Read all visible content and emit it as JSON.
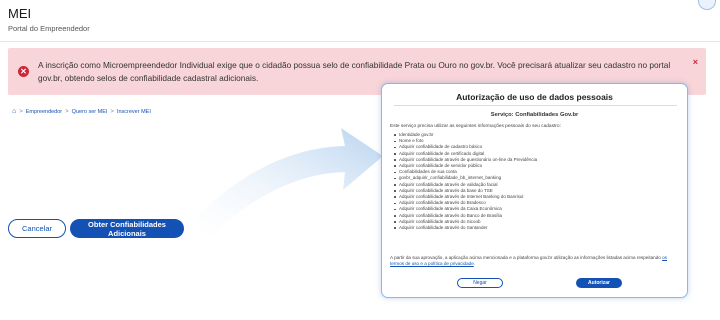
{
  "header": {
    "title": "MEI",
    "subtitle": "Portal do Empreendedor"
  },
  "alert": {
    "message": "A inscrição como Microempreendedor Individual exige que o cidadão possua selo de confiabilidade Prata ou Ouro no gov.br. Você precisará atualizar seu cadastro no portal gov.br, obtendo selos de confiabilidade cadastral adicionais.",
    "icon": "x-circle-icon",
    "close_label": "×",
    "color": "#d0263c"
  },
  "breadcrumb": {
    "items": [
      "Empreendedor",
      "Quero ser MEI",
      "Inscrever MEI"
    ],
    "separator": ">"
  },
  "actions": {
    "cancel_label": "Cancelar",
    "primary_label": "Obter Confiabilidades Adicionais",
    "accent": "#1351b4"
  },
  "modal": {
    "title": "Autorização de uso de dados pessoais",
    "service": "Serviço: Confiabilidades Gov.br",
    "intro": "Este serviço precisa utilizar as seguintes informações pessoais do seu cadastro:",
    "items": [
      "Identidade gov.br",
      "Nome e foto",
      "Adquirir confiabilidade de cadastro básico",
      "Adquirir confiabilidade de certificado digital",
      "Adquirir confiabilidade através de questionário on-line da Previdência",
      "Adquirir confiabilidade de servidor público",
      "Confiabilidades de sua conta",
      "govbr_adquirir_confiabilidade_bb_internet_banking",
      "Adquirir confiabilidade através de validação facial",
      "Adquirir confiabilidade através da base do TSE",
      "Adquirir confiabilidade através de Internet Banking do Banrisul",
      "Adquirir confiabilidade através do Bradesco",
      "Adquirir confiabilidade através da Caixa Econômica",
      "Adquirir confiabilidade através do Banco de Brasília",
      "Adquirir confiabilidade através do Sicoob",
      "Adquirir confiabilidade através do Santander"
    ],
    "consent_prefix": "A partir da sua aprovação, a aplicação acima mencionada e a plataforma gov.br utilização as informações listadas acima respeitando ",
    "consent_link": "os termos de uso e a política de privacidade",
    "consent_suffix": ".",
    "deny_label": "Negar",
    "authorize_label": "Autorizar"
  }
}
